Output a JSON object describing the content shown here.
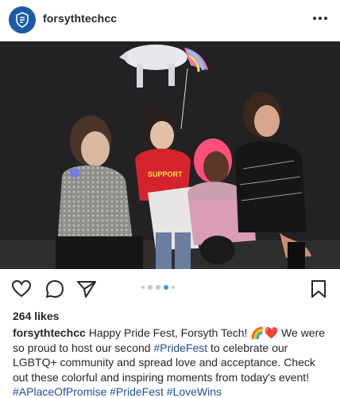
{
  "header": {
    "username": "forsythtechcc",
    "avatar_icon": "shield-logo-icon",
    "more_icon": "more-horizontal-icon"
  },
  "post": {
    "image_description_icon": "photo",
    "carousel": {
      "total": 5,
      "active_index": 3
    }
  },
  "actions": {
    "like_icon": "heart-icon",
    "comment_icon": "comment-icon",
    "share_icon": "send-icon",
    "save_icon": "bookmark-icon"
  },
  "likes_label": "264 likes",
  "caption": {
    "user": "forsythtechcc",
    "text_1": " Happy Pride Fest, Forsyth Tech! 🌈❤️ We were so proud to host our second ",
    "tag_1": "#PrideFest",
    "text_2": " to celebrate our LGBTQ+ community and spread love and acceptance. Check out these colorful and inspiring moments from today's event! ",
    "tag_2": "#APlaceOfPromise",
    "tag_3": "#PrideFest",
    "tag_4": "#LoveWins"
  },
  "colors": {
    "accent_blue": "#3897f0",
    "hashtag": "#1f4e9b",
    "brand_avatar": "#1d5aa8"
  }
}
